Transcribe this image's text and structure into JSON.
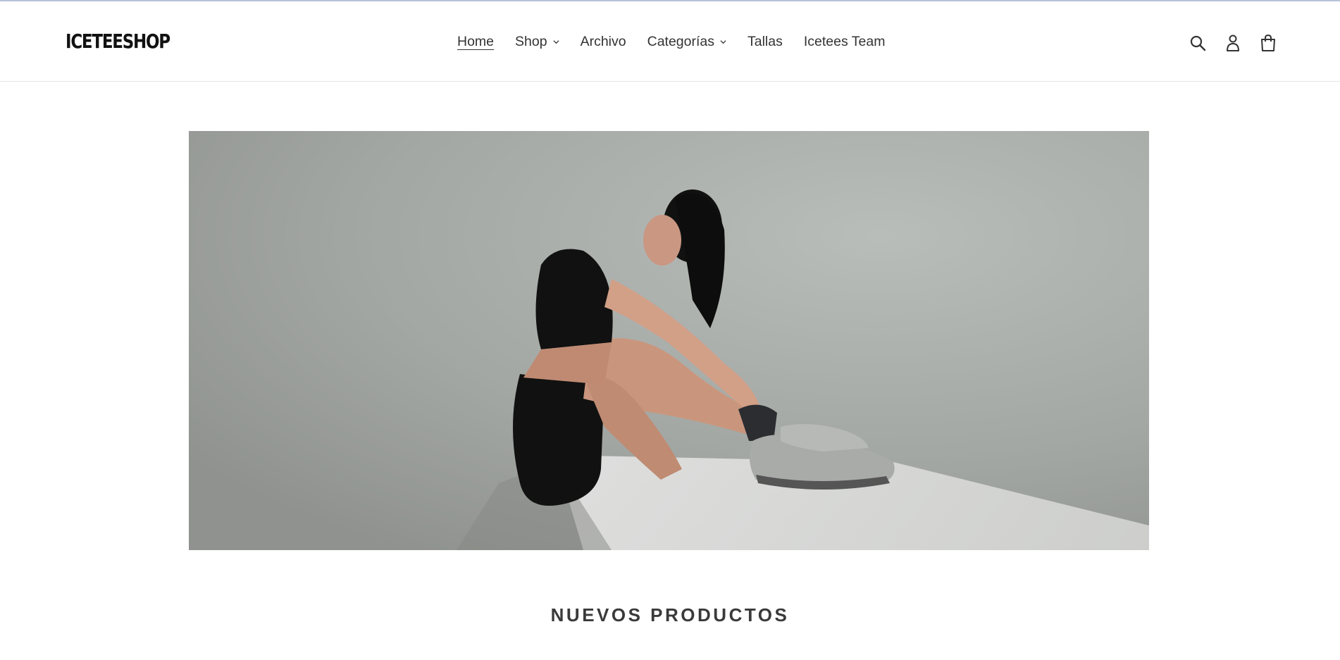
{
  "brand": {
    "logo_text": "ICETEESHOP"
  },
  "nav": {
    "items": [
      {
        "label": "Home",
        "active": true,
        "has_dropdown": false
      },
      {
        "label": "Shop",
        "active": false,
        "has_dropdown": true
      },
      {
        "label": "Archivo",
        "active": false,
        "has_dropdown": false
      },
      {
        "label": "Categorías",
        "active": false,
        "has_dropdown": true
      },
      {
        "label": "Tallas",
        "active": false,
        "has_dropdown": false
      },
      {
        "label": "Icetees Team",
        "active": false,
        "has_dropdown": false
      }
    ]
  },
  "header_icons": [
    "search-icon",
    "account-icon",
    "cart-icon"
  ],
  "hero": {
    "image": "model-sitting-black-outfit-sneakers"
  },
  "sections": {
    "new_products_title": "NUEVOS PRODUCTOS"
  },
  "colors": {
    "text": "#3a3a3a",
    "border": "#e6e6e6",
    "hero_bg": "#a6aaa6"
  }
}
